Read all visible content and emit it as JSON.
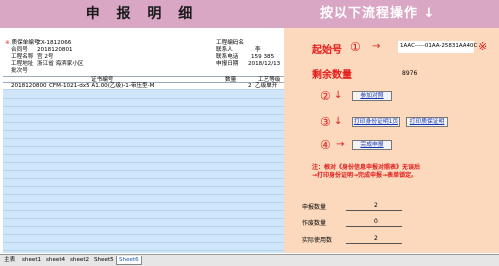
{
  "banner": {
    "title": "申 报 明 细",
    "instruction": "按以下流程操作 ↓"
  },
  "header_fields": {
    "row1": {
      "label": "质保单编号",
      "value": "ZX-1812066",
      "label2": "工程编码名"
    },
    "row2": {
      "label": "合同号",
      "value": "2018120801",
      "label2": "联系人",
      "value2": "李"
    },
    "row3": {
      "label": "工程名称",
      "value": "宫          2号",
      "label2": "联系电话",
      "value2": "159           385"
    },
    "row4": {
      "label": "工程地址",
      "value": "浙江省           海滨家小区",
      "label2": "申报日期",
      "value2": "2018/12/13"
    },
    "row5": {
      "label": "批次号",
      "col_cert": "证书编号",
      "col_qty": "数量",
      "col_grade": "工艺等级"
    }
  },
  "data_rows": [
    {
      "batch": "2018120800",
      "cert": "CFM-1021-dx5 A1.00(乙级)-1-带压型-M",
      "qty": "2",
      "grade": "乙级单开"
    }
  ],
  "right_panel": {
    "start_label": "起始号",
    "start_circle": "①",
    "arrow": "→",
    "start_value": "1AAC-----01AA-25831AA40C",
    "start_star": "※",
    "remain_label": "剩余数量",
    "remain_value": "8976",
    "step2": "②",
    "step2_arrow": "↓",
    "step2_btn": "参加对照",
    "step3": "③",
    "step3_arrow": "↓",
    "step3_btn1": "打印身份证明1页",
    "step3_btn2": "打印质保证明",
    "step4": "④",
    "step4_arrow": "→",
    "step4_btn": "完成申报",
    "note_line1": "注：根对《身份信息申报对照表》无误后",
    "note_line2": "→打印身份证明→完成申报→表单锁定。",
    "stat1_label": "申报数量",
    "stat1_value": "2",
    "stat2_label": "作废数量",
    "stat2_value": "0",
    "stat3_label": "实际使用数",
    "stat3_value": "2"
  },
  "sheet_tabs": [
    "主表",
    "sheet1",
    "sheet4",
    "sheet2",
    "Sheet5",
    "Sheet6"
  ],
  "active_tab_index": 5,
  "colors": {
    "banner": "#d9a6c4",
    "right_panel": "#fcd9bd",
    "grid": "#cfe6fa",
    "accent_red": "#e31b1b"
  }
}
